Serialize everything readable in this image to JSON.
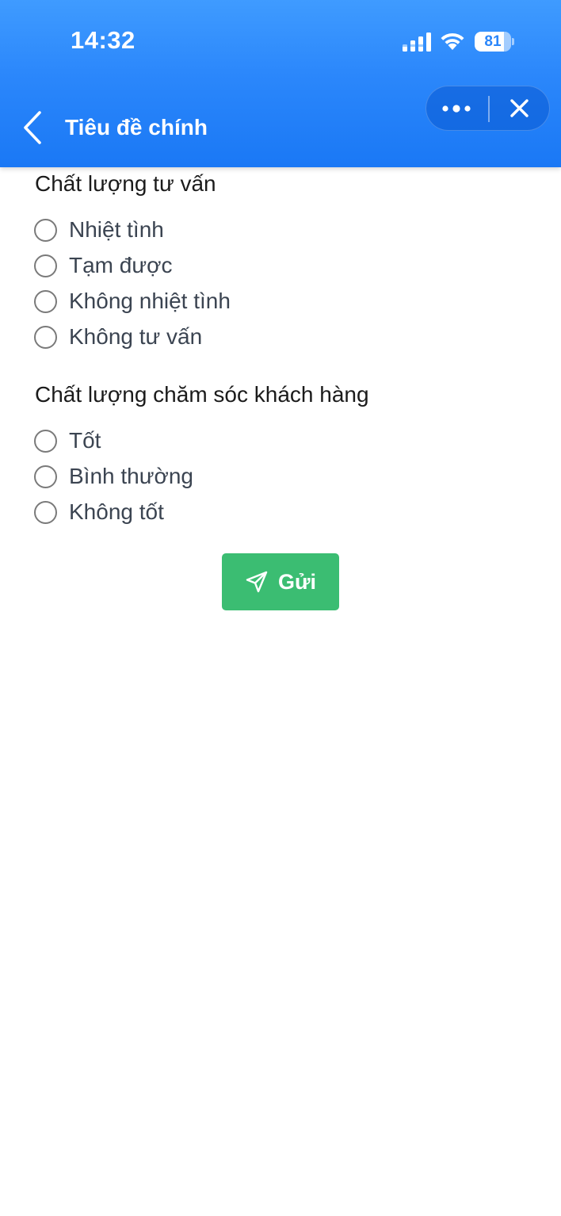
{
  "status_bar": {
    "time": "14:32",
    "battery_level": "81",
    "battery_fraction": 0.81,
    "icons": [
      "signal-icon",
      "wifi-icon",
      "battery-icon"
    ]
  },
  "header": {
    "title": "Tiêu đề chính",
    "back_icon": "chevron-left-icon",
    "more_icon": "more-horizontal-icon",
    "close_icon": "close-icon"
  },
  "survey": {
    "sections": [
      {
        "title": "Chất lượng tư vấn",
        "options": [
          "Nhiệt tình",
          "Tạm được",
          "Không nhiệt tình",
          "Không tư vấn"
        ]
      },
      {
        "title": "Chất lượng chăm sóc khách hàng",
        "options": [
          "Tốt",
          "Bình thường",
          "Không tốt"
        ]
      }
    ]
  },
  "submit": {
    "label": "Gửi",
    "icon": "send-icon"
  },
  "colors": {
    "header_top": "#3f9bff",
    "header_bottom": "#1a78f5",
    "submit_green": "#3bbd72",
    "option_text": "#3b4451",
    "radio_border": "#7a7a7a"
  }
}
